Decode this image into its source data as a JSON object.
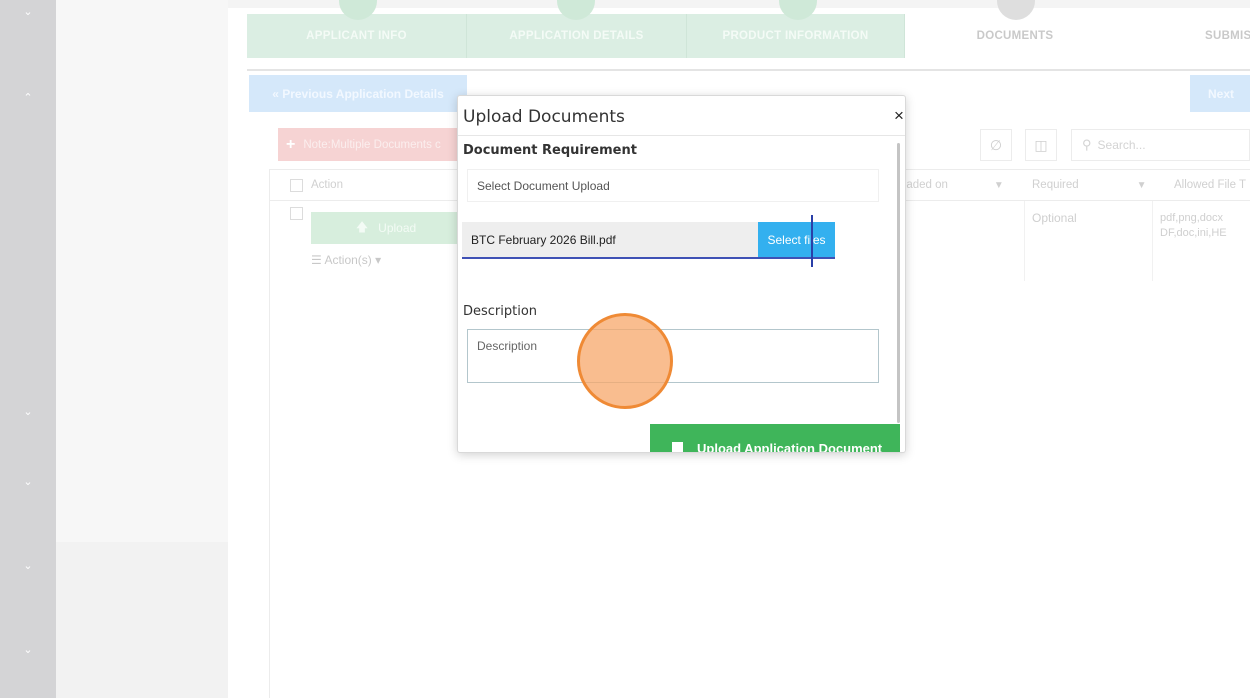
{
  "steps": [
    {
      "label": "APPLICANT INFO",
      "state": "done"
    },
    {
      "label": "APPLICATION DETAILS",
      "state": "done"
    },
    {
      "label": "PRODUCT INFORMATION",
      "state": "done"
    },
    {
      "label": "DOCUMENTS",
      "state": "current"
    },
    {
      "label": "SUBMIS",
      "state": "pending"
    }
  ],
  "nav": {
    "prev_label": "« Previous Application Details",
    "next_label": "Next",
    "rail_icons": [
      "chevron-down-icon",
      "chevron-up-icon",
      "chevron-down-icon",
      "chevron-down-icon",
      "chevron-down-icon",
      "chevron-down-icon"
    ]
  },
  "toolbar": {
    "note_label": "Note:Multiple Documents c",
    "search_placeholder": "Search..."
  },
  "grid": {
    "headers": {
      "action": "Action",
      "uploaded_on": "ploaded on",
      "required": "Required",
      "allowed": "Allowed File T"
    },
    "row": {
      "upload_label": "Upload",
      "actions_label": "Action(s)",
      "required": "Optional",
      "allowed": "pdf,png,docx DF,doc,ini,HE"
    }
  },
  "modal": {
    "title": "Upload Documents",
    "close_glyph": "×",
    "doc_requirement_label": "Document Requirement",
    "select_placeholder": "Select Document Upload",
    "file_name": "BTC February 2026 Bill.pdf",
    "select_files_label": "Select files",
    "description_label": "Description",
    "description_placeholder": "Description",
    "submit_label": "Upload Application Document"
  },
  "colors": {
    "accent_blue": "#33b0ef",
    "success_green": "#3fb55a",
    "underline": "#3f51b5",
    "click_marker": "#ef8a35"
  }
}
